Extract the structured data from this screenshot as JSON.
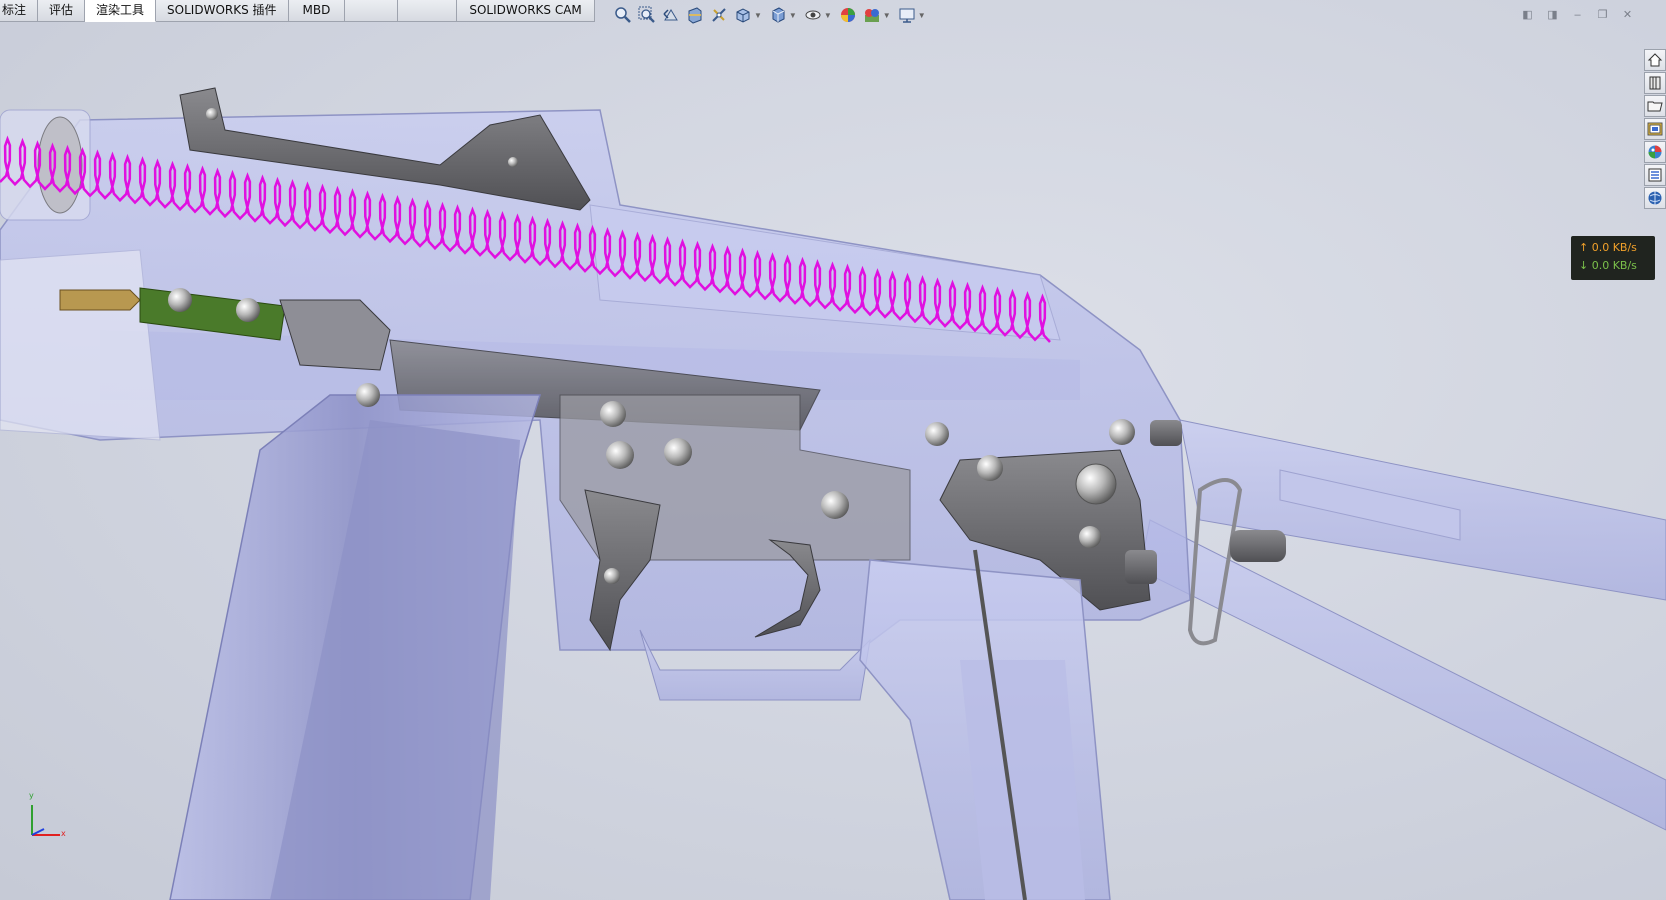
{
  "command_tabs": [
    {
      "label": "标注",
      "active": false
    },
    {
      "label": "评估",
      "active": false
    },
    {
      "label": "渲染工具",
      "active": true
    },
    {
      "label": "SOLIDWORKS 插件",
      "active": false
    },
    {
      "label": "MBD",
      "active": false
    },
    {
      "label": "",
      "active": false
    },
    {
      "label": "",
      "active": false
    },
    {
      "label": "SOLIDWORKS CAM",
      "active": false
    }
  ],
  "heads_up_toolbar": [
    "zoom-to-fit-icon",
    "zoom-to-area-icon",
    "previous-view-icon",
    "section-view-icon",
    "dynamic-annotation-icon",
    "view-orientation-icon",
    "display-style-icon",
    "hide-show-items-icon",
    "edit-appearance-icon",
    "apply-scene-icon",
    "view-settings-icon"
  ],
  "task_pane": [
    "solidworks-resources-icon",
    "design-library-icon",
    "file-explorer-icon",
    "view-palette-icon",
    "appearances-scenes-icon",
    "custom-properties-icon",
    "forum-icon"
  ],
  "net_speed": {
    "up": "0.0 KB/s",
    "down": "0.0 KB/s",
    "up_color": "#f0a02a",
    "down_color": "#7ac04a"
  },
  "triad": {
    "x": "x",
    "y": "y"
  },
  "colors": {
    "spring": "#e010e0",
    "ghost_part": "#b8bce8",
    "steel": "#6e6e72",
    "background": "#cfd3de"
  }
}
